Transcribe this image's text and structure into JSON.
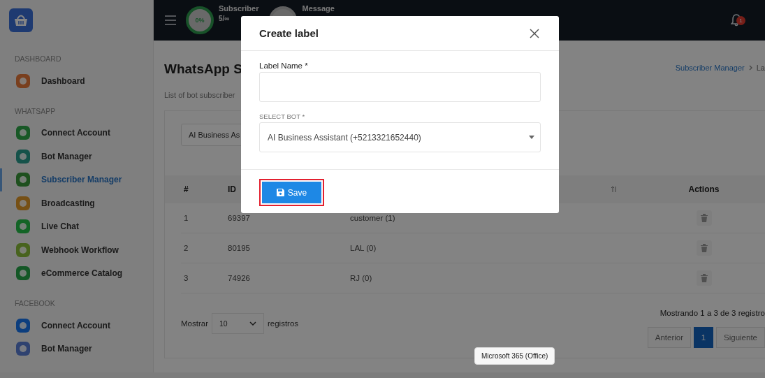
{
  "header": {
    "stats": [
      {
        "label": "Subscriber",
        "value": "5/∞",
        "percent": "0%"
      },
      {
        "label": "Message"
      }
    ],
    "notifications": {
      "count": "1"
    }
  },
  "sidebar": {
    "sections": [
      {
        "title": "DASHBOARD",
        "items": [
          {
            "label": "Dashboard",
            "selected": false
          }
        ]
      },
      {
        "title": "WHATSAPP",
        "items": [
          {
            "label": "Connect Account",
            "selected": false
          },
          {
            "label": "Bot Manager",
            "selected": false
          },
          {
            "label": "Subscriber Manager",
            "selected": true
          },
          {
            "label": "Broadcasting",
            "selected": false
          },
          {
            "label": "Live Chat",
            "selected": false
          },
          {
            "label": "Webhook Workflow",
            "selected": false
          },
          {
            "label": "eCommerce Catalog",
            "selected": false
          }
        ]
      },
      {
        "title": "FACEBOOK",
        "items": [
          {
            "label": "Connect Account",
            "selected": false
          },
          {
            "label": "Bot Manager",
            "selected": false
          }
        ]
      }
    ]
  },
  "page": {
    "title": "WhatsApp S",
    "subtitle": "List of bot subscriber",
    "breadcrumb": [
      "Subscriber Manager",
      "La"
    ],
    "bot_filter": {
      "value": "AI Business As"
    }
  },
  "table": {
    "columns": [
      {
        "label": "#"
      },
      {
        "label": "ID"
      },
      {
        "sortable": true
      },
      {
        "label": "Actions"
      }
    ],
    "rows": [
      {
        "index": "1",
        "id": "69397",
        "label": "customer (1)"
      },
      {
        "index": "2",
        "id": "80195",
        "label": "LAL (0)"
      },
      {
        "index": "3",
        "id": "74926",
        "label": "RJ (0)"
      }
    ],
    "length": {
      "prefix": "Mostrar",
      "value": "10",
      "suffix": "registros"
    },
    "info": "Mostrando 1 a 3 de 3 registro",
    "pagination": [
      {
        "label": "Anterior",
        "selected": false
      },
      {
        "label": "1",
        "selected": true
      },
      {
        "label": "Siguiente",
        "selected": false
      }
    ]
  },
  "modal": {
    "title": "Create label",
    "fields": [
      {
        "kind": "text",
        "label": "Label Name *"
      },
      {
        "kind": "select",
        "label": "SELECT BOT *",
        "value": "AI Business Assistant (+5213321652440)"
      }
    ],
    "save_button": {
      "label": "Save",
      "highlighted": true
    }
  },
  "tooltip": "Microsoft 365 (Office)"
}
